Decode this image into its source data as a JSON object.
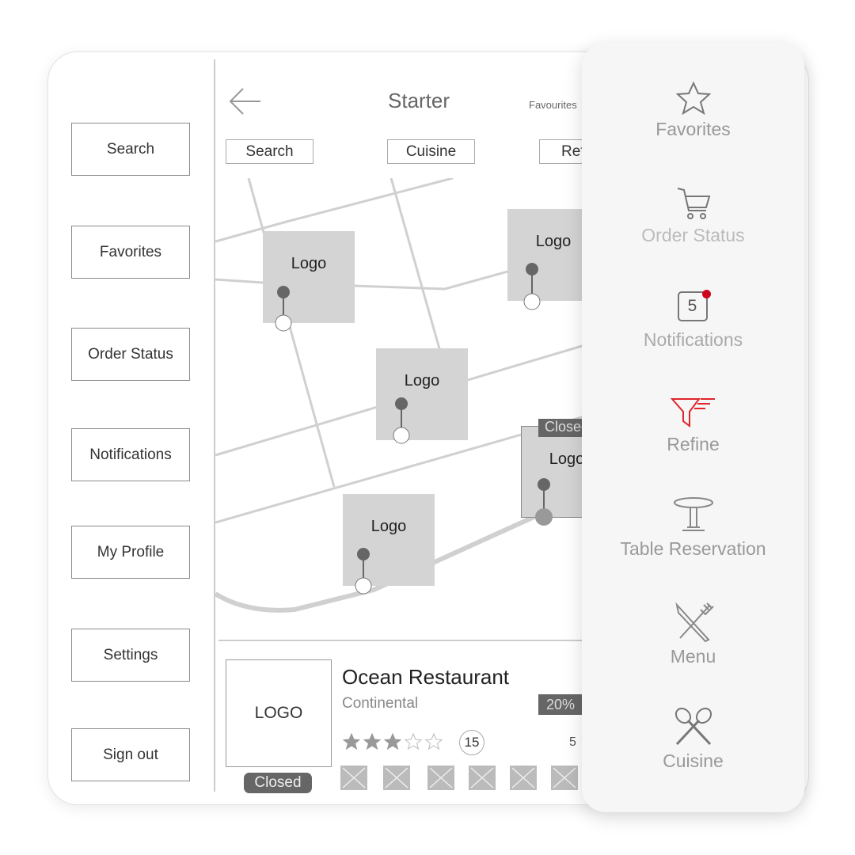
{
  "sidebar": {
    "items": [
      {
        "label": "Search"
      },
      {
        "label": "Favorites"
      },
      {
        "label": "Order Status"
      },
      {
        "label": "Notifications"
      },
      {
        "label": "My Profile"
      },
      {
        "label": "Settings"
      },
      {
        "label": "Sign out"
      }
    ]
  },
  "header": {
    "title": "Starter",
    "favourites_label": "Favourites",
    "back_icon": "arrow-left-icon"
  },
  "filters": [
    {
      "label": "Search"
    },
    {
      "label": "Cuisine"
    },
    {
      "label": "Refine"
    }
  ],
  "map": {
    "markers": [
      {
        "label": "Logo"
      },
      {
        "label": "Logo"
      },
      {
        "label": "Logo"
      },
      {
        "label": "Logo",
        "status": "Closed"
      },
      {
        "label": "Logo"
      }
    ]
  },
  "restaurant": {
    "logo": "LOGO",
    "status": "Closed",
    "name": "Ocean Restaurant",
    "cuisine": "Continental",
    "discount": "20%",
    "rating": 3,
    "rating_max": 5,
    "review_count": "15",
    "extra_value": "5"
  },
  "panel": {
    "accent": "#e0262b",
    "items": [
      {
        "label": "Favorites",
        "icon": "star-icon"
      },
      {
        "label": "Order Status",
        "icon": "cart-icon"
      },
      {
        "label": "Notifications",
        "icon": "notification-icon",
        "badge": "5"
      },
      {
        "label": "Refine",
        "icon": "filter-icon",
        "active": true
      },
      {
        "label": "Table Reservation",
        "icon": "table-icon"
      },
      {
        "label": "Menu",
        "icon": "fork-knife-icon"
      },
      {
        "label": "Cuisine",
        "icon": "crossed-utensils-icon"
      }
    ]
  }
}
